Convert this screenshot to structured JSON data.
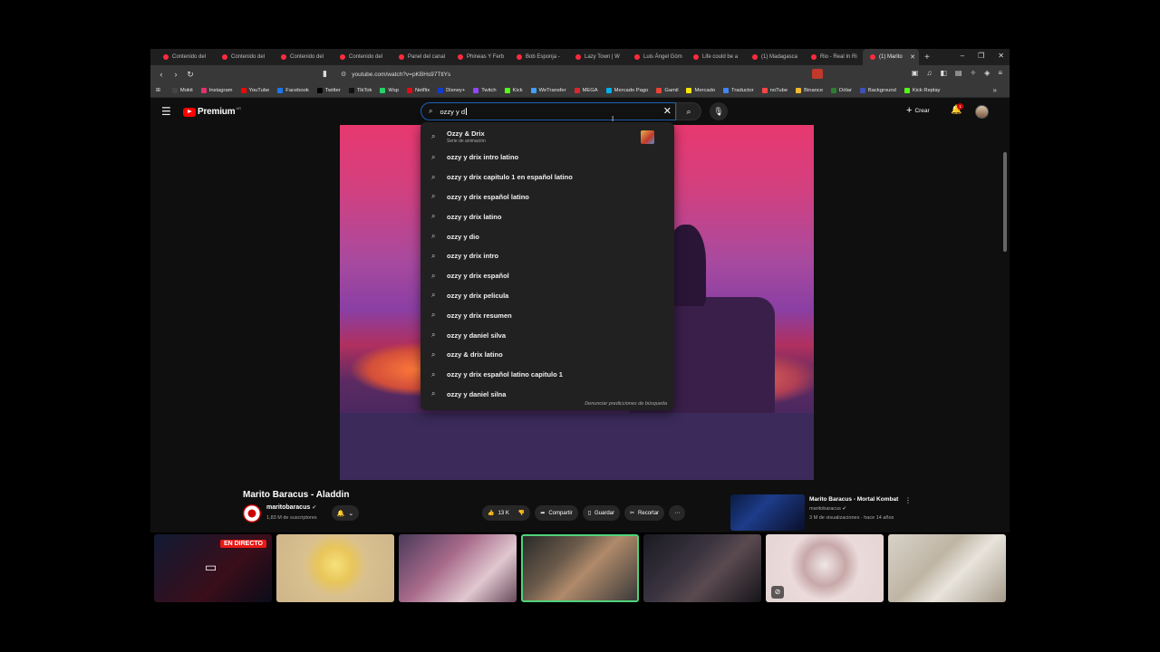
{
  "tabs": [
    {
      "label": "Contenido del"
    },
    {
      "label": "Contenido del"
    },
    {
      "label": "Contenido del"
    },
    {
      "label": "Contenido del"
    },
    {
      "label": "Panel del canal"
    },
    {
      "label": "Phineas Y Ferb"
    },
    {
      "label": "Bob Esponja -"
    },
    {
      "label": "Lazy Town | W"
    },
    {
      "label": "Luis Ángel Góm"
    },
    {
      "label": "Life could be a"
    },
    {
      "label": "(1) Madagasca"
    },
    {
      "label": "Rio - Real In Ri"
    },
    {
      "label": "(1) Marito"
    }
  ],
  "url": "youtube.com/watch?v=pKBHs97TtlYs",
  "bookmarks": [
    {
      "label": "Mokit",
      "color": "#444"
    },
    {
      "label": "Instagram",
      "color": "#e1306c"
    },
    {
      "label": "YouTube",
      "color": "#ff0000"
    },
    {
      "label": "Facebook",
      "color": "#1877f2"
    },
    {
      "label": "Twitter",
      "color": "#000000"
    },
    {
      "label": "TikTok",
      "color": "#111111"
    },
    {
      "label": "Wsp",
      "color": "#25d366"
    },
    {
      "label": "Netflix",
      "color": "#e50914"
    },
    {
      "label": "Disney+",
      "color": "#113ccf"
    },
    {
      "label": "Twitch",
      "color": "#9146ff"
    },
    {
      "label": "Kick",
      "color": "#53fc18"
    },
    {
      "label": "WeTransfer",
      "color": "#409fff"
    },
    {
      "label": "MEGA",
      "color": "#d9272e"
    },
    {
      "label": "Mercado Pago",
      "color": "#00b1ea"
    },
    {
      "label": "Gamil",
      "color": "#ea4335"
    },
    {
      "label": "Mercado",
      "color": "#ffe600"
    },
    {
      "label": "Traductor",
      "color": "#4285f4"
    },
    {
      "label": "noTube",
      "color": "#ff4444"
    },
    {
      "label": "Binance",
      "color": "#f3ba2f"
    },
    {
      "label": "Dólar",
      "color": "#2e7d32"
    },
    {
      "label": "Background",
      "color": "#3f51b5"
    },
    {
      "label": "Kick Replay",
      "color": "#53fc18"
    }
  ],
  "yt": {
    "logo_text": "Premium",
    "logo_cc": "AR",
    "search_value": "ozzy y d",
    "create_label": "Crear",
    "notif_count": "1"
  },
  "suggestions": {
    "first": {
      "label": "Ozzy & Drix",
      "sub": "Serie de animación"
    },
    "items": [
      "ozzy y drix intro latino",
      "ozzy y drix capitulo 1 en español latino",
      "ozzy y drix español latino",
      "ozzy y drix latino",
      "ozzy y dio",
      "ozzy y drix intro",
      "ozzy y drix español",
      "ozzy y drix pelicula",
      "ozzy y drix resumen",
      "ozzy y daniel silva",
      "ozzy & drix latino",
      "ozzy y drix español latino capitulo 1",
      "ozzy y daniel silna"
    ],
    "report": "Denunciar predicciones de búsqueda"
  },
  "video": {
    "title": "Marito Baracus - Aladdin",
    "channel": "maritobaracus",
    "subs": "1,83 M de suscriptores",
    "likes": "13 K",
    "share": "Compartir",
    "save": "Guardar",
    "clip": "Recortar"
  },
  "recommended": {
    "title": "Marito Baracus - Mortal Kombat",
    "channel": "maritobaracus",
    "meta": "3 M de visualizaciones · hace 14 años"
  },
  "live_badge": "EN DIRECTO"
}
